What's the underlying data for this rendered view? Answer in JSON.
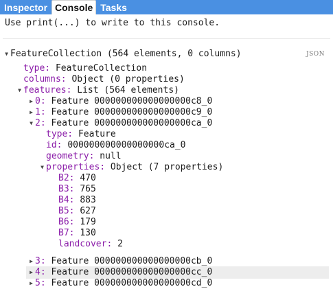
{
  "tabs": [
    {
      "label": "Inspector",
      "active": false
    },
    {
      "label": "Console",
      "active": true
    },
    {
      "label": "Tasks",
      "active": false
    }
  ],
  "console": {
    "hint": "Use print(...) to write to this console.",
    "json_label": "JSON",
    "root": "FeatureCollection (564 elements, 0 columns)",
    "type_key": "type:",
    "type_val": "FeatureCollection",
    "columns_key": "columns:",
    "columns_val": "Object (0 properties)",
    "features_key": "features:",
    "features_val": "List (564 elements)",
    "items": [
      {
        "key": "0:",
        "val": "Feature 000000000000000000c8_0"
      },
      {
        "key": "1:",
        "val": "Feature 000000000000000000c9_0"
      },
      {
        "key": "2:",
        "val": "Feature 000000000000000000ca_0"
      },
      {
        "key": "3:",
        "val": "Feature 000000000000000000cb_0"
      },
      {
        "key": "4:",
        "val": "Feature 000000000000000000cc_0"
      },
      {
        "key": "5:",
        "val": "Feature 000000000000000000cd_0"
      }
    ],
    "f2": {
      "type_key": "type:",
      "type_val": "Feature",
      "id_key": "id:",
      "id_val": "000000000000000000ca_0",
      "geometry_key": "geometry:",
      "geometry_val": "null",
      "properties_key": "properties:",
      "properties_val": "Object (7 properties)",
      "props": [
        {
          "key": "B2:",
          "val": "470"
        },
        {
          "key": "B3:",
          "val": "765"
        },
        {
          "key": "B4:",
          "val": "883"
        },
        {
          "key": "B5:",
          "val": "627"
        },
        {
          "key": "B6:",
          "val": "179"
        },
        {
          "key": "B7:",
          "val": "130"
        },
        {
          "key": "landcover:",
          "val": "2"
        }
      ]
    },
    "icons": {
      "expanded": "triangle-down-icon",
      "collapsed": "triangle-right-icon"
    }
  }
}
